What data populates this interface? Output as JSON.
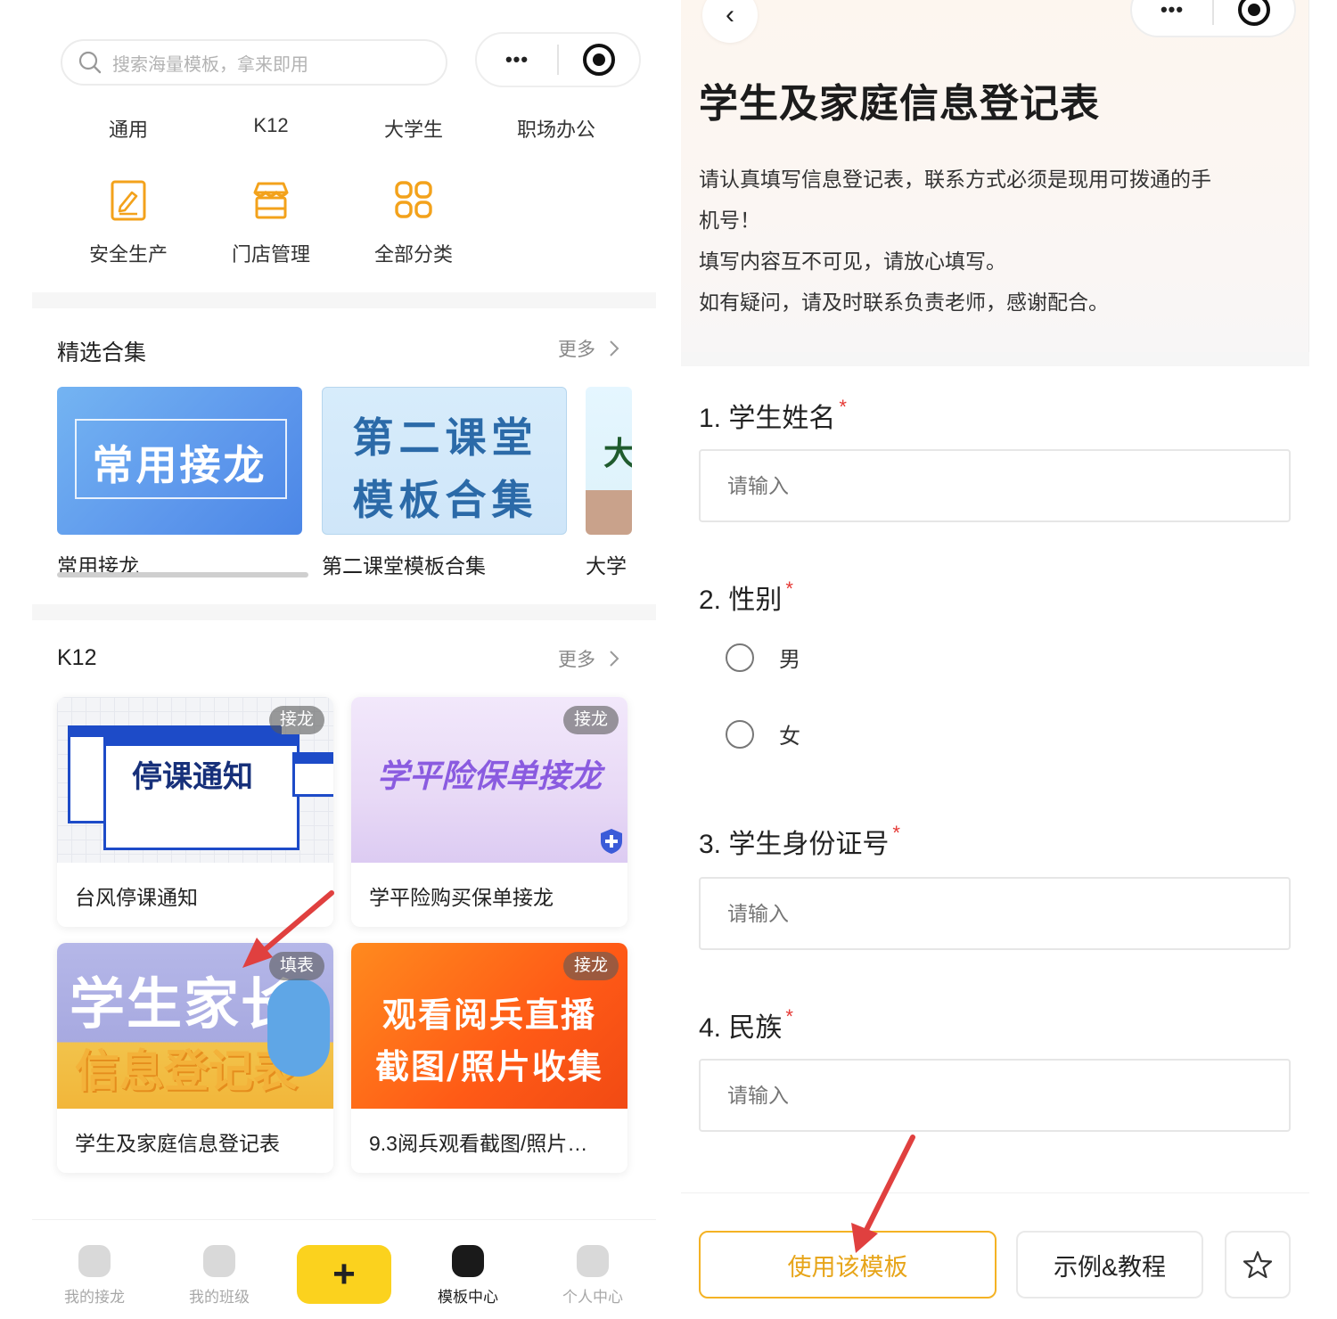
{
  "left": {
    "search": {
      "placeholder": "搜索海量模板，拿来即用"
    },
    "capsule": {
      "more": "•••"
    },
    "categories": [
      "通用",
      "K12",
      "大学生",
      "职场办公"
    ],
    "icon_categories": [
      {
        "label": "安全生产",
        "icon": "safety-production-icon"
      },
      {
        "label": "门店管理",
        "icon": "store-icon"
      },
      {
        "label": "全部分类",
        "icon": "all-categories-icon"
      }
    ],
    "featured": {
      "title": "精选合集",
      "more": "更多",
      "items": [
        {
          "caption": "常用接龙",
          "image_text": "常用接龙"
        },
        {
          "caption": "第二课堂模板合集",
          "image_text_1": "第二课堂",
          "image_text_2": "模板合集"
        },
        {
          "caption": "大学",
          "image_text": "大"
        }
      ]
    },
    "k12": {
      "title": "K12",
      "more": "更多",
      "cards": [
        {
          "caption": "台风停课通知",
          "badge": "接龙",
          "thumb_text": "停课通知"
        },
        {
          "caption": "学平险购买保单接龙",
          "badge": "接龙",
          "thumb_text": "学平险保单接龙"
        },
        {
          "caption": "学生及家庭信息登记表",
          "badge": "填表",
          "thumb_text_1": "学生家长",
          "thumb_text_2": "信息登记表"
        },
        {
          "caption": "9.3阅兵观看截图/照片…",
          "badge": "接龙",
          "thumb_text_1": "观看阅兵直播",
          "thumb_text_2": "截图/照片收集"
        }
      ]
    },
    "tabbar": {
      "items": [
        "我的接龙",
        "我的班级",
        "模板中心",
        "个人中心"
      ],
      "plus": "+"
    }
  },
  "right": {
    "back": "‹",
    "capsule": {
      "more": "•••"
    },
    "title": "学生及家庭信息登记表",
    "description": [
      "请认真填写信息登记表，联系方式必须是现用可拨通的手",
      "机号！",
      "填写内容互不可见，请放心填写。",
      "如有疑问，请及时联系负责老师，感谢配合。"
    ],
    "questions": {
      "q1": {
        "label": "1. 学生姓名",
        "required": "*",
        "placeholder": "请输入"
      },
      "q2": {
        "label": "2. 性别",
        "required": "*",
        "options": [
          "男",
          "女"
        ]
      },
      "q3": {
        "label": "3. 学生身份证号",
        "required": "*",
        "placeholder": "请输入"
      },
      "q4": {
        "label": "4. 民族",
        "required": "*",
        "placeholder": "请输入"
      }
    },
    "buttons": {
      "use_template": "使用该模板",
      "examples": "示例&教程"
    }
  },
  "colors": {
    "accent_yellow": "#fbd21e",
    "use_button": "#f4b224",
    "required_star": "#e53935",
    "annotation_arrow": "#e0403f"
  }
}
